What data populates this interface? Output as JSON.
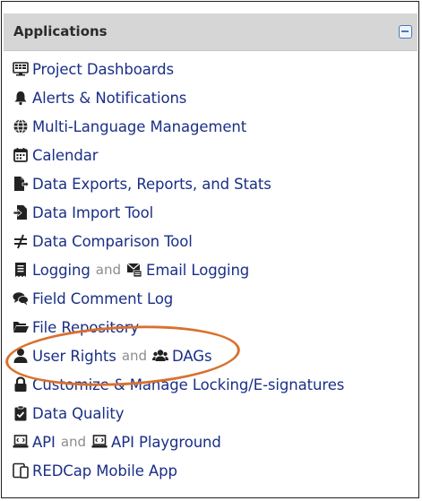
{
  "panel": {
    "title": "Applications",
    "collapse_icon": "minus-square-icon",
    "accent_color": "#1a2f86",
    "highlight_color": "#d8712f"
  },
  "items": [
    {
      "label": "Project Dashboards",
      "icon": "dashboard-monitor-icon"
    },
    {
      "label": "Alerts & Notifications",
      "icon": "bell-icon"
    },
    {
      "label": "Multi-Language Management",
      "icon": "globe-icon"
    },
    {
      "label": "Calendar",
      "icon": "calendar-icon"
    },
    {
      "label": "Data Exports, Reports, and Stats",
      "icon": "file-export-icon"
    },
    {
      "label": "Data Import Tool",
      "icon": "file-import-icon"
    },
    {
      "label": "Data Comparison Tool",
      "icon": "not-equal-icon"
    },
    {
      "label": "Logging",
      "icon": "receipt-icon",
      "sep": "and",
      "label2": "Email Logging",
      "icon2": "mail-log-icon"
    },
    {
      "label": "Field Comment Log",
      "icon": "comments-icon"
    },
    {
      "label": "File Repository",
      "icon": "folder-open-icon"
    },
    {
      "label": "User Rights",
      "icon": "user-icon",
      "sep": "and",
      "label2": "DAGs",
      "icon2": "users-group-icon"
    },
    {
      "label": "Customize & Manage Locking/E-signatures",
      "icon": "lock-icon"
    },
    {
      "label": "Data Quality",
      "icon": "clipboard-check-icon"
    },
    {
      "label": "API",
      "icon": "api-laptop-icon",
      "sep": "and",
      "label2": "API Playground",
      "icon2": "api-laptop-icon"
    },
    {
      "label": "REDCap Mobile App",
      "icon": "mobile-tablet-icon"
    }
  ]
}
